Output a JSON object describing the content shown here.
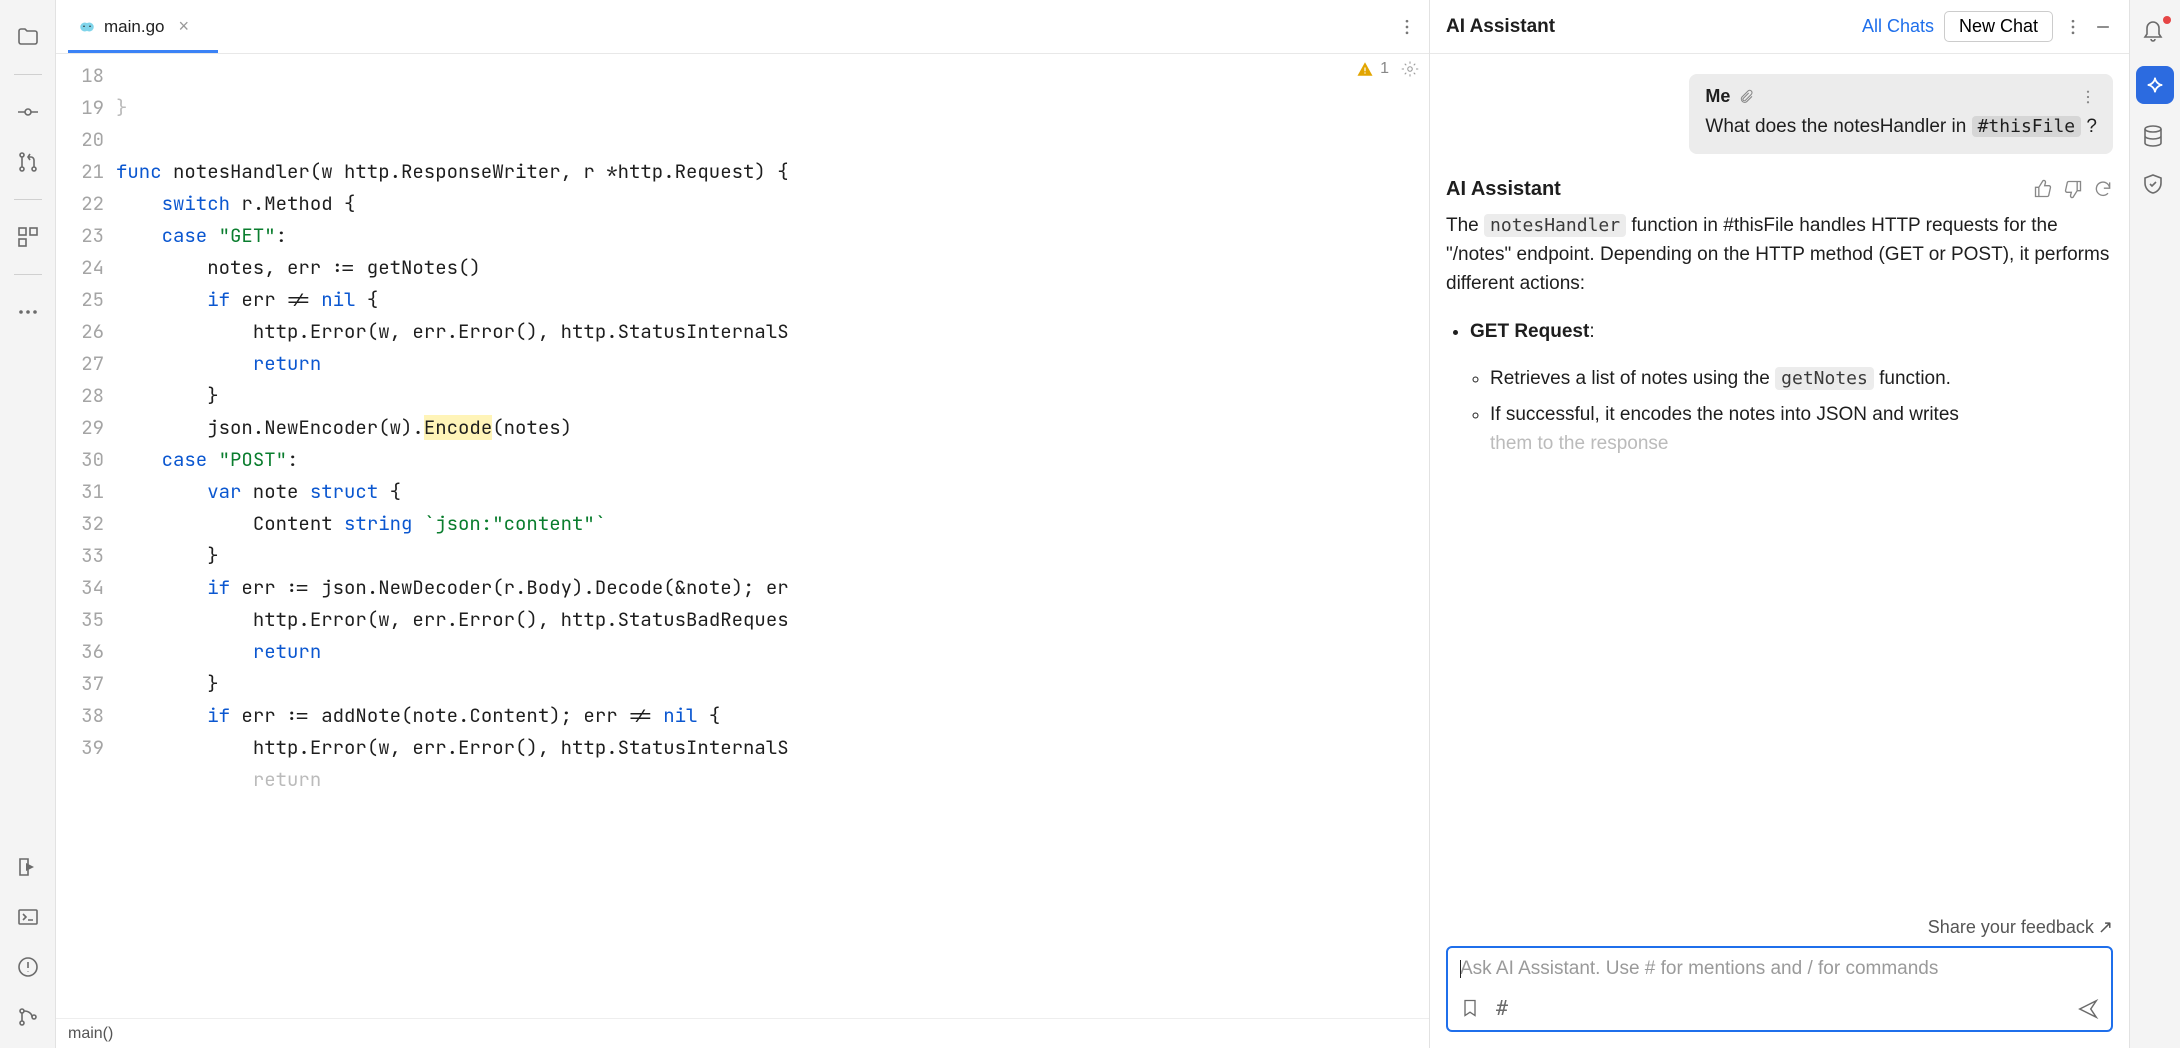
{
  "tab": {
    "filename": "main.go"
  },
  "inspection": {
    "warning_count": "1"
  },
  "breadcrumb": {
    "text": "main()"
  },
  "gutter": {
    "start": 18,
    "end": 39
  },
  "code": {
    "l18": "}",
    "l19": "",
    "l21_a": "switch",
    "l21_b": " r.Method {",
    "l22_a": "case ",
    "l22_b": "\"GET\"",
    "l22_c": ":",
    "l23": "notes, err := getNotes()",
    "l24_a": "if",
    "l24_b": " err != ",
    "l24_c": "nil",
    "l24_d": " {",
    "l25": "http.Error(w, err.Error(), http.StatusInternalS",
    "l26": "return",
    "l27": "}",
    "l28_a": "json.NewEncoder(w).",
    "l28_b": "Encode",
    "l28_c": "(notes)",
    "l29_a": "case ",
    "l29_b": "\"POST\"",
    "l29_c": ":",
    "l30_a": "var",
    "l30_b": " note ",
    "l30_c": "struct",
    "l30_d": " {",
    "l31_a": "Content ",
    "l31_b": "string",
    "l31_c": " `json:",
    "l31_d": "\"content\"",
    "l31_e": "`",
    "l32": "}",
    "l33_a": "if",
    "l33_b": " err := json.NewDecoder(r.Body).Decode(&note); er",
    "l34": "http.Error(w, err.Error(), http.StatusBadReques",
    "l35": "return",
    "l36": "}",
    "l37_a": "if",
    "l37_b": " err := addNote(note.Content); err != ",
    "l37_c": "nil",
    "l37_d": " {",
    "l38": "http.Error(w, err.Error(), http.StatusInternalS",
    "l39": "return",
    "funcline": {
      "kw": "func",
      "name": " notesHandler(w http.ResponseWriter, r *http.Request) {"
    }
  },
  "ai": {
    "panel_title": "AI Assistant",
    "all_chats": "All Chats",
    "new_chat": "New Chat",
    "me_label": "Me",
    "me_question_a": "What does the notesHandler in ",
    "me_question_chip": "#thisFile",
    "me_question_b": " ?",
    "assist_label": "AI Assistant",
    "p1_a": "The ",
    "p1_code": "notesHandler",
    "p1_b": " function in #thisFile handles HTTP requests for the \"/notes\" endpoint. Depending on the HTTP method (GET or POST), it performs different actions:",
    "bullet_get": "GET Request",
    "sub1_a": "Retrieves a list of notes using the ",
    "sub1_code": "getNotes",
    "sub1_b": " function.",
    "sub2": "If successful, it encodes the notes into JSON and writes",
    "sub2_fade": "them to the response",
    "feedback": "Share your feedback",
    "placeholder": "Ask AI Assistant. Use # for mentions and / for commands"
  }
}
